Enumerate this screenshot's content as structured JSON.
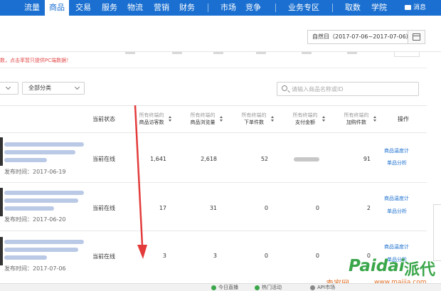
{
  "nav": {
    "items": [
      {
        "label": "流量",
        "active": false
      },
      {
        "label": "商品",
        "active": true
      },
      {
        "label": "交易",
        "active": false
      },
      {
        "label": "服务",
        "active": false
      },
      {
        "label": "物流",
        "active": false
      },
      {
        "label": "营销",
        "active": false
      },
      {
        "label": "财务",
        "active": false
      },
      {
        "label": "市场",
        "active": false
      },
      {
        "label": "竞争",
        "active": false
      },
      {
        "label": "业务专区",
        "active": false
      },
      {
        "label": "取数",
        "active": false
      },
      {
        "label": "学院",
        "active": false
      }
    ],
    "message_label": "消息"
  },
  "date_range": "自然日（2017-07-06~2017-07-06）",
  "notice": "数，点击率暂只提供PC端数据！",
  "filters": {
    "category_select": "全部分类",
    "search_placeholder": "请输入商品名称或ID"
  },
  "table": {
    "status_header": "当前状态",
    "op_header": "操作",
    "metric_headers": [
      {
        "top": "所有终端的",
        "bottom": "商品访客数"
      },
      {
        "top": "所有终端的",
        "bottom": "商品浏览量"
      },
      {
        "top": "所有终端的",
        "bottom": "下单件数"
      },
      {
        "top": "所有终端的",
        "bottom": "支付金额"
      },
      {
        "top": "所有终端的",
        "bottom": "加购件数"
      }
    ],
    "publish_prefix": "发布时间：",
    "rows": [
      {
        "publish_date": "2017-06-19",
        "status": "当前在线",
        "visitors": "1,641",
        "views": "2,618",
        "orders": "52",
        "payment": "",
        "cart": "91",
        "ops": [
          "商品温度计",
          "单品分析"
        ]
      },
      {
        "publish_date": "2017-06-20",
        "status": "当前在线",
        "visitors": "17",
        "views": "31",
        "orders": "0",
        "payment": "0",
        "cart": "2",
        "ops": [
          "商品温度计",
          "单品分析"
        ]
      },
      {
        "publish_date": "2017-07-06",
        "status": "当前在线",
        "visitors": "3",
        "views": "3",
        "orders": "0",
        "payment": "0",
        "cart": "0",
        "ops": [
          "商品温度计",
          "单品分析"
        ]
      }
    ]
  },
  "bottom_bar": {
    "items": [
      "今日直播",
      "热门活动",
      "API市场"
    ]
  },
  "watermark": {
    "site": "卖家网",
    "url": "www.maijia.com",
    "brand_latin": "Paidai",
    "brand_cn": "派代"
  },
  "colors": {
    "brand_blue": "#1a6fd0",
    "notice_red": "#e34b4b",
    "annotation_red": "#e33b3b",
    "watermark_green": "#3aa64a"
  },
  "icons": [
    "calendar-icon",
    "search-icon",
    "sort-icon",
    "message-icon",
    "chevron-down-icon"
  ]
}
